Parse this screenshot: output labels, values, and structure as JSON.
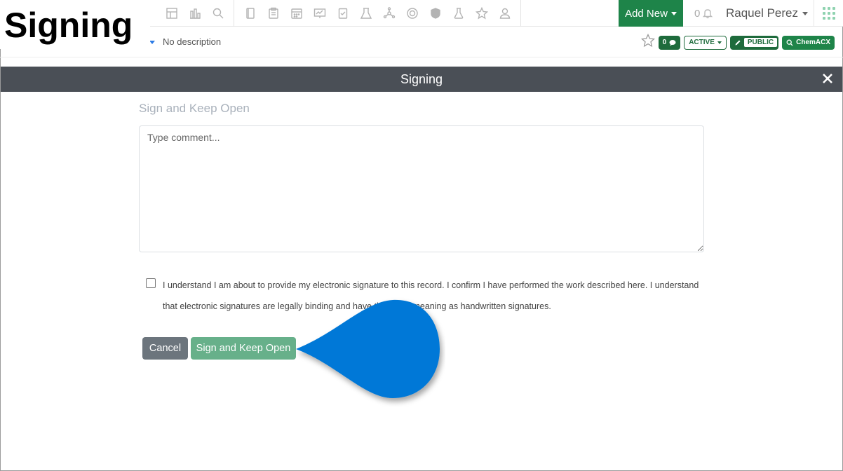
{
  "overlay": {
    "heading": "Signing"
  },
  "toolbar": {
    "icons": [
      "dashboard-icon",
      "chart-icon",
      "search-icon",
      "notebook-icon",
      "clipboard-icon",
      "calendar-icon",
      "presentation-icon",
      "checklist-icon",
      "lab-icon",
      "molecule-icon",
      "gauge-icon",
      "shield-icon",
      "flask-icon",
      "star-icon",
      "users-icon"
    ],
    "add_new_label": "Add New",
    "notification_count": "0",
    "user_name": "Raquel Perez"
  },
  "record": {
    "description": "No description",
    "comment_count": "0",
    "status_label": "ACTIVE",
    "visibility_label": "PUBLIC",
    "search_label": "ChemACX"
  },
  "modal": {
    "title": "Signing",
    "section_title": "Sign and Keep Open",
    "comment_placeholder": "Type comment...",
    "consent_text": "I understand I am about to provide my electronic signature to this record. I confirm I have performed the work described here. I understand that electronic signatures are legally binding and have the same meaning as handwritten signatures.",
    "consent_checked": false,
    "cancel_label": "Cancel",
    "sign_label": "Sign and Keep Open"
  },
  "colors": {
    "primary_green": "#1e8449",
    "sign_button": "#67b08a",
    "cancel_button": "#6c757d",
    "modal_header": "#4a4f56",
    "pointer_blue": "#0478d7"
  }
}
